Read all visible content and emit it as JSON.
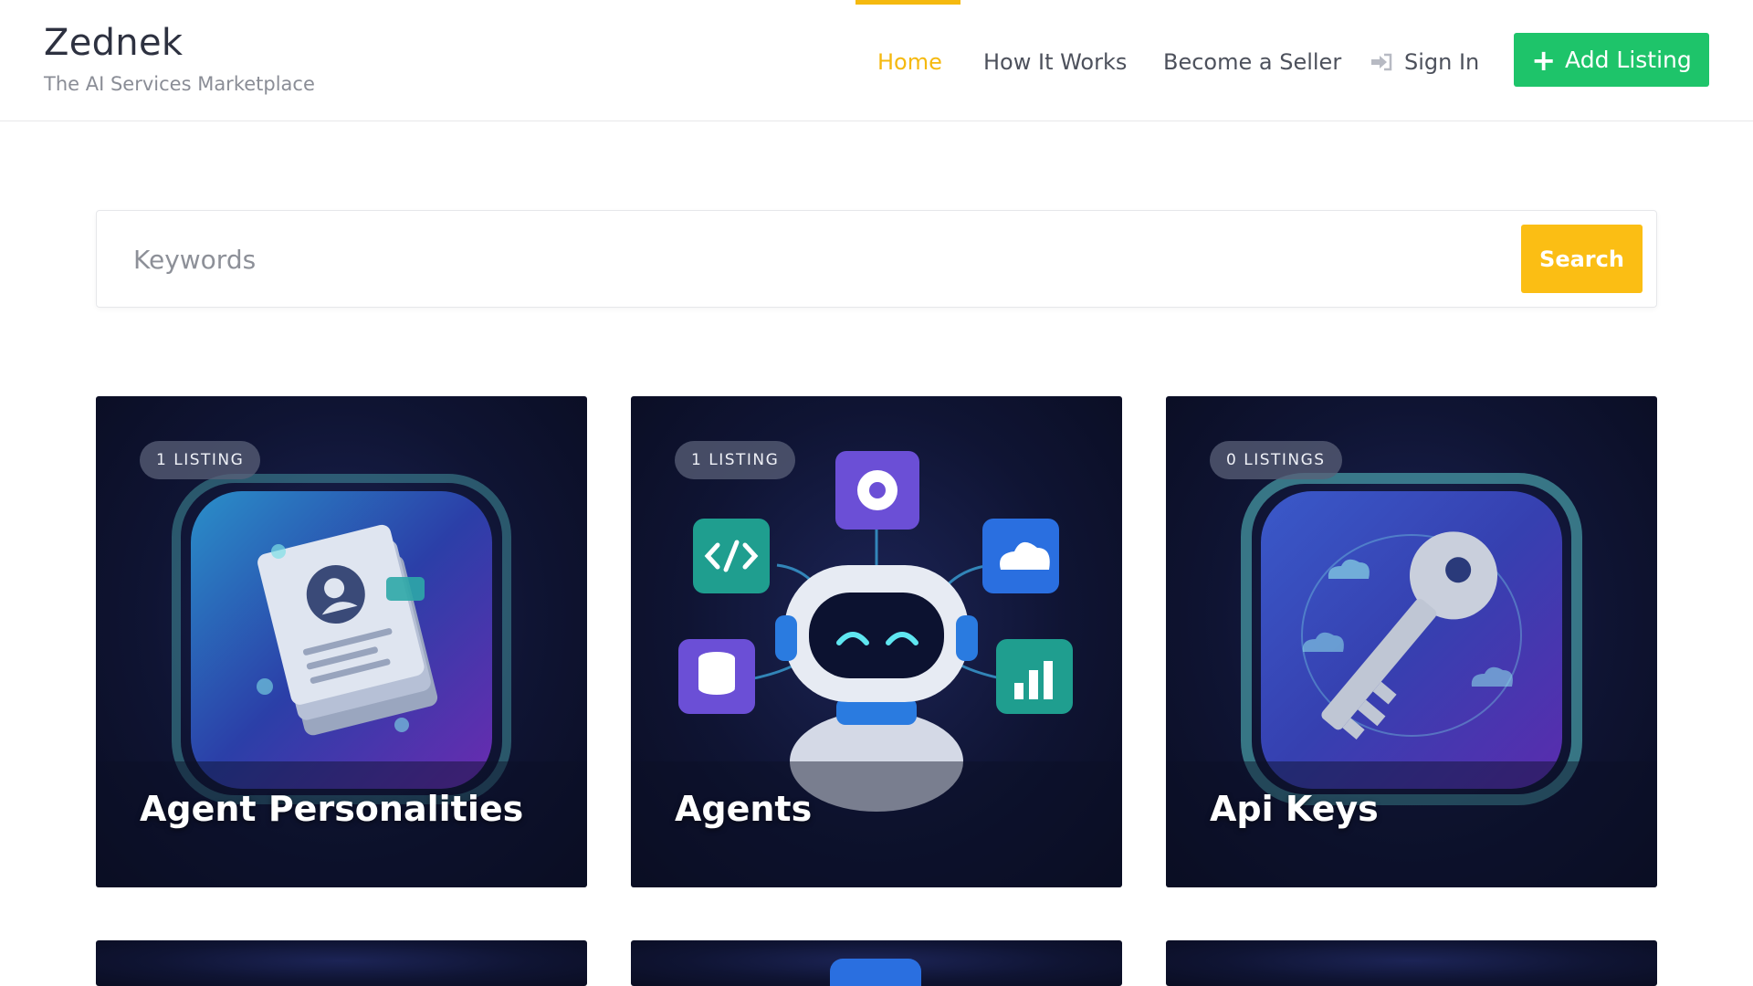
{
  "brand": {
    "title": "Zednek",
    "subtitle": "The AI Services Marketplace"
  },
  "nav": {
    "items": [
      {
        "label": "Home",
        "active": true
      },
      {
        "label": "How It Works",
        "active": false
      },
      {
        "label": "Become a Seller",
        "active": false
      },
      {
        "label": "Sign In",
        "active": false,
        "icon": "sign-in-icon"
      }
    ],
    "add_listing_label": "Add Listing"
  },
  "search": {
    "placeholder": "Keywords",
    "value": "",
    "button_label": "Search"
  },
  "categories": [
    {
      "badge": "1 LISTING",
      "title": "Agent Personalities",
      "icon": "document-profile-icon"
    },
    {
      "badge": "1 LISTING",
      "title": "Agents",
      "icon": "robot-icon"
    },
    {
      "badge": "0 LISTINGS",
      "title": "Api Keys",
      "icon": "key-icon"
    }
  ],
  "colors": {
    "accent": "#f5b90f",
    "add_button": "#1ec46a",
    "search_button": "#fbbe14",
    "card_bg": "#0f1433"
  }
}
